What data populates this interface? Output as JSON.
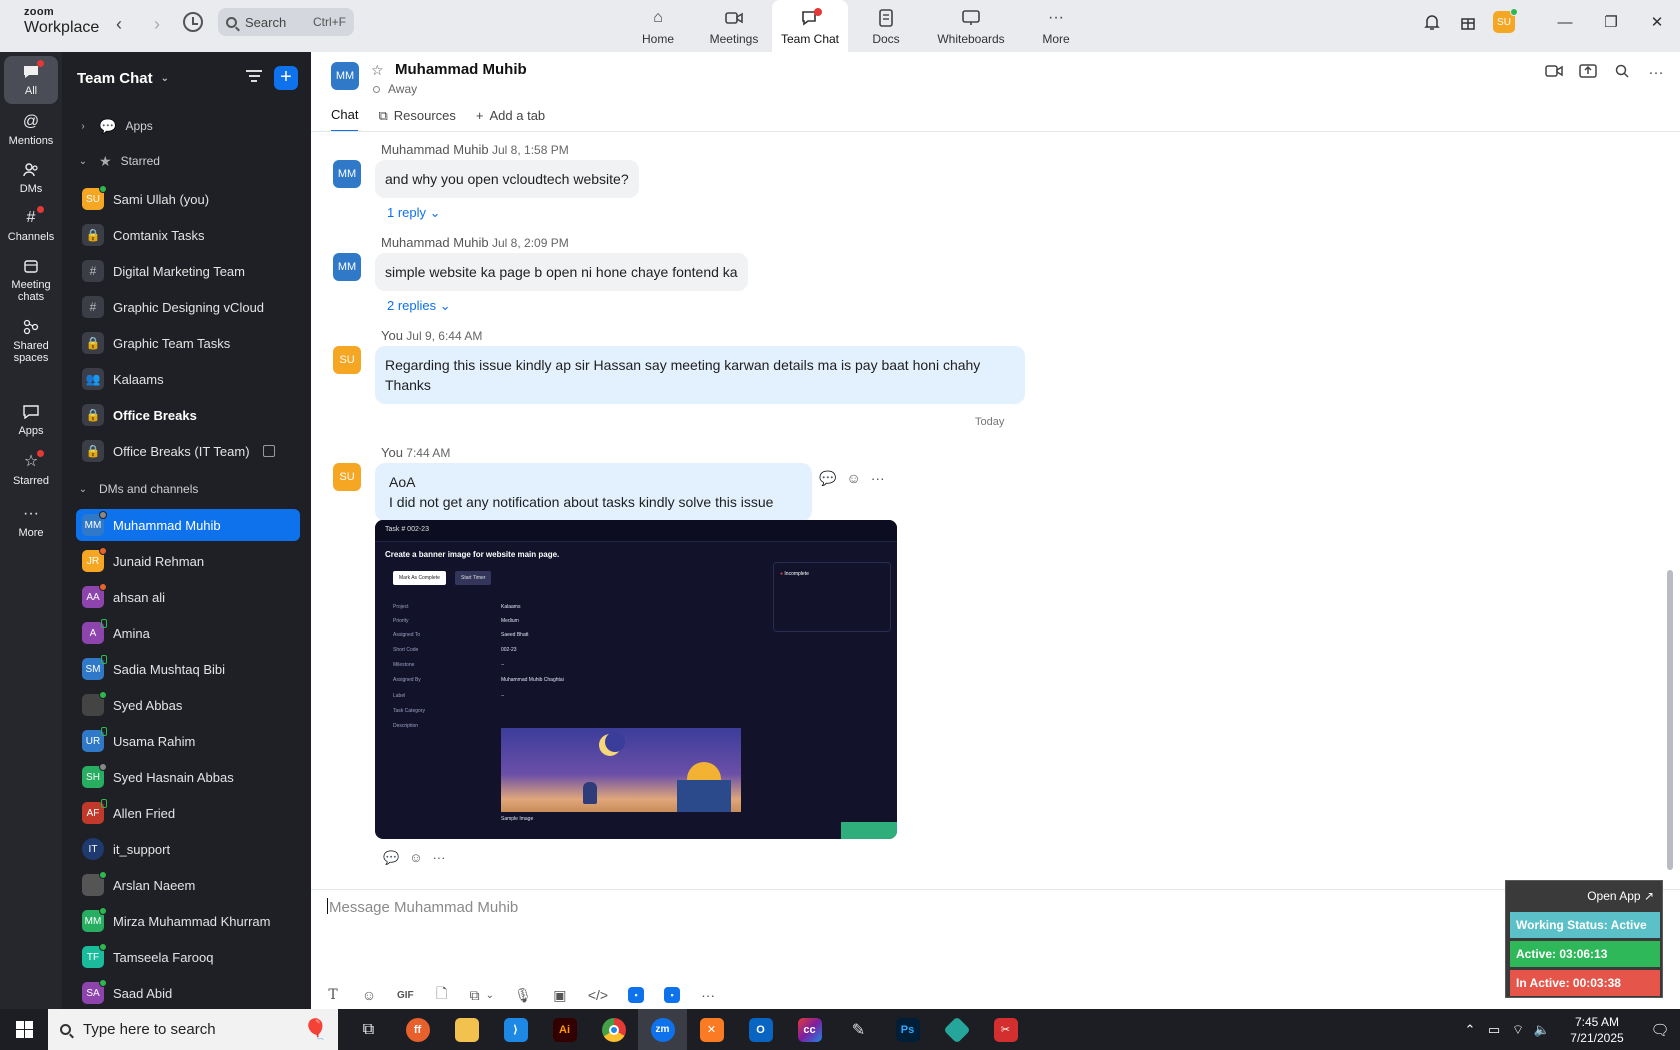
{
  "app": {
    "brand_top": "zoom",
    "brand_bottom": "Workplace",
    "search_placeholder": "Search",
    "search_shortcut": "Ctrl+F"
  },
  "top_tabs": [
    {
      "label": "Home",
      "icon": "home-icon"
    },
    {
      "label": "Meetings",
      "icon": "video-camera-icon"
    },
    {
      "label": "Team Chat",
      "icon": "chat-bubble-icon",
      "active": true
    },
    {
      "label": "Docs",
      "icon": "document-icon"
    },
    {
      "label": "Whiteboards",
      "icon": "whiteboard-icon"
    },
    {
      "label": "More",
      "icon": "more-icon"
    }
  ],
  "user": {
    "initials": "SU",
    "avatar_color": "#f5a623"
  },
  "rail": [
    {
      "label": "All",
      "icon": "chat-bubble-icon"
    },
    {
      "label": "Mentions",
      "icon": "at-icon"
    },
    {
      "label": "DMs",
      "icon": "people-icon"
    },
    {
      "label": "Channels",
      "icon": "hash-icon"
    },
    {
      "label": "Meeting chats",
      "icon": "calendar-icon"
    },
    {
      "label": "Shared spaces",
      "icon": "share-icon"
    },
    {
      "label": "Apps",
      "icon": "apps-icon"
    },
    {
      "label": "Starred",
      "icon": "star-icon"
    },
    {
      "label": "More",
      "icon": "more-icon"
    }
  ],
  "sidebar": {
    "title": "Team Chat",
    "apps_label": "Apps",
    "starred_label": "Starred",
    "starred": [
      {
        "name": "Sami Ullah (you)",
        "initials": "SU",
        "color": "#f5a623"
      },
      {
        "name": "Comtanix Tasks"
      },
      {
        "name": "Digital Marketing Team"
      },
      {
        "name": "Graphic Designing vCloud"
      },
      {
        "name": "Graphic Team Tasks"
      },
      {
        "name": "Kalaams"
      },
      {
        "name": "Office Breaks"
      },
      {
        "name": "Office Breaks (IT Team)"
      }
    ],
    "dms_label": "DMs and channels",
    "dms": [
      {
        "name": "Muhammad Muhib",
        "initials": "MM",
        "color": "#2f79c8"
      },
      {
        "name": "Junaid Rehman",
        "initials": "JR",
        "color": "#f5a623"
      },
      {
        "name": "ahsan ali",
        "initials": "AA",
        "color": "#8e44ad"
      },
      {
        "name": "Amina",
        "initials": "A",
        "color": "#8e44ad"
      },
      {
        "name": "Sadia Mushtaq Bibi",
        "initials": "SM",
        "color": "#2f79c8"
      },
      {
        "name": "Syed Abbas",
        "initials": "",
        "color": "#444444"
      },
      {
        "name": "Usama Rahim",
        "initials": "UR",
        "color": "#2f79c8"
      },
      {
        "name": "Syed Hasnain Abbas",
        "initials": "SH",
        "color": "#27ae60"
      },
      {
        "name": "Allen Fried",
        "initials": "AF",
        "color": "#c0392b"
      },
      {
        "name": "it_support",
        "initials": "IT",
        "color": "#1e3a6e"
      },
      {
        "name": "Arslan Naeem",
        "initials": "",
        "color": "#555555"
      },
      {
        "name": "Mirza Muhammad Khurram",
        "initials": "MM",
        "color": "#27ae60"
      },
      {
        "name": "Tamseela Farooq",
        "initials": "TF",
        "color": "#1abc9c"
      },
      {
        "name": "Saad Abid",
        "initials": "SA",
        "color": "#8e44ad"
      }
    ]
  },
  "chat": {
    "contact_name": "Muhammad Muhib",
    "contact_initials": "MM",
    "status": "Away",
    "tabs": [
      "Chat",
      "Resources",
      "Add a tab"
    ],
    "messages": [
      {
        "sender": "Muhammad Muhib",
        "time": "Jul 8, 1:58 PM",
        "initials": "MM",
        "text": "and why you open vcloudtech website?",
        "replies": "1 reply"
      },
      {
        "sender": "Muhammad Muhib",
        "time": "Jul 8, 2:09 PM",
        "initials": "MM",
        "text": "simple website ka page b open ni hone chaye fontend ka",
        "replies": "2 replies"
      },
      {
        "sender": "You",
        "time": "Jul 9, 6:44 AM",
        "initials": "SU",
        "text1": "Regarding this issue kindly ap sir Hassan say meeting karwan details ma is pay baat honi chahy",
        "text2": "Thanks"
      },
      {
        "sender": "You",
        "time": "7:44 AM",
        "initials": "SU",
        "text1": "AoA",
        "text2": "I did not get any notification about tasks kindly solve this issue"
      }
    ],
    "date_divider": "Today",
    "attachment": {
      "header": "Task # 002-23",
      "title": "Create a banner image for website main page.",
      "btn_complete": "Mark As Complete",
      "btn_timer": "Start Timer",
      "status": "Incomplete",
      "fields": [
        "Project",
        "Priority",
        "Assigned To",
        "Short Code",
        "Milestone",
        "Assigned By",
        "Label",
        "Task Category",
        "Description"
      ],
      "values": [
        "Kalaams",
        "Medium",
        "Saeed Bhatt",
        "002-23",
        "--",
        "Muhammad Muhib Chaghtai",
        "--"
      ],
      "image_caption": "Sample Image"
    },
    "composer_placeholder": "Message Muhammad Muhib"
  },
  "widget": {
    "open_app": "Open App",
    "working_status": "Working Status: Active",
    "active": "Active: 03:06:13",
    "inactive": "In Active: 00:03:38",
    "colors": {
      "status": "#5bc0c7",
      "active": "#2fb85a",
      "inactive": "#e6554a"
    }
  },
  "taskbar": {
    "search_placeholder": "Type here to search",
    "time": "7:45 AM",
    "date": "7/21/2025",
    "apps": [
      "task-view-icon",
      "firefox-icon",
      "file-explorer-icon",
      "vscode-icon",
      "illustrator-icon",
      "chrome-icon",
      "zoom-icon",
      "xampp-icon",
      "outlook-icon",
      "creative-cloud-icon",
      "pen-tool-icon",
      "photoshop-icon",
      "gem-icon",
      "snipping-tool-icon"
    ]
  }
}
